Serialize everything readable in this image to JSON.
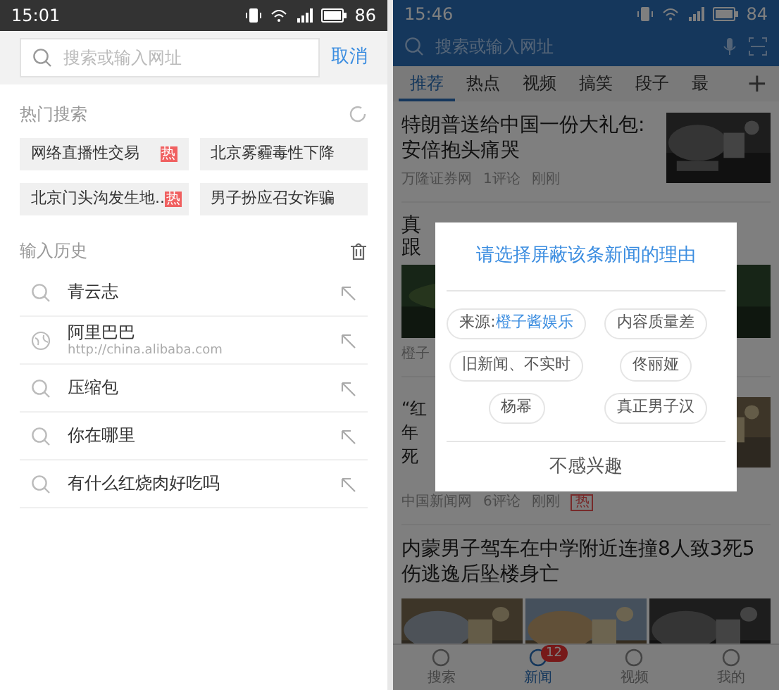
{
  "left_screen": {
    "status_bar": {
      "time": "15:01",
      "battery": "86"
    },
    "search": {
      "placeholder": "搜索或输入网址",
      "cancel": "取消"
    },
    "hot_search": {
      "title": "热门搜索",
      "items": [
        {
          "text": "网络直播性交易",
          "badge": "热"
        },
        {
          "text": "北京雾霾毒性下降"
        },
        {
          "text": "北京门头沟发生地..",
          "badge": "热"
        },
        {
          "text": "男子扮应召女诈骗"
        }
      ]
    },
    "history": {
      "title": "输入历史",
      "items": [
        {
          "kind": "query",
          "text": "青云志"
        },
        {
          "kind": "site",
          "text": "阿里巴巴",
          "url": "http://china.alibaba.com"
        },
        {
          "kind": "query",
          "text": "压缩包"
        },
        {
          "kind": "query",
          "text": "你在哪里"
        },
        {
          "kind": "query",
          "text": "有什么红烧肉好吃吗"
        }
      ]
    }
  },
  "right_screen": {
    "status_bar": {
      "time": "15:46",
      "battery": "84"
    },
    "search": {
      "placeholder": "搜索或输入网址"
    },
    "tabs": [
      {
        "label": "推荐",
        "selected": true
      },
      {
        "label": "热点",
        "selected": false
      },
      {
        "label": "视频",
        "selected": false
      },
      {
        "label": "搞笑",
        "selected": false
      },
      {
        "label": "段子",
        "selected": false
      },
      {
        "label": "最",
        "selected": false
      }
    ],
    "add_tab": "+",
    "news": [
      {
        "kind": "single",
        "title": "特朗普送给中国一份大礼包:安倍抱头痛哭",
        "source": "万隆证券网",
        "comments": "1评论",
        "time": "刚刚"
      },
      {
        "kind": "covered_wide",
        "fragments": [
          "真",
          "跟"
        ],
        "source": "橙子"
      },
      {
        "kind": "covered_single",
        "fragments": [
          "“红",
          "年",
          "死"
        ],
        "source": "中国新闻网",
        "comments": "6评论",
        "time": "刚刚",
        "badge": "热"
      },
      {
        "kind": "gallery",
        "title": "内蒙男子驾车在中学附近连撞8人致3死5伤逃逸后坠楼身亡"
      }
    ],
    "dialog": {
      "title": "请选择屏蔽该条新闻的理由",
      "reasons": [
        {
          "kind": "source",
          "label": "来源:",
          "value": "橙子酱娱乐"
        },
        {
          "kind": "plain",
          "label": "内容质量差"
        },
        {
          "kind": "plain",
          "label": "旧新闻、不实时"
        },
        {
          "kind": "plain",
          "label": "佟丽娅"
        },
        {
          "kind": "plain",
          "label": "杨幂"
        },
        {
          "kind": "plain",
          "label": "真正男子汉"
        }
      ],
      "dismiss": "不感兴趣"
    },
    "bottom_nav": [
      {
        "label": "搜索",
        "selected": false
      },
      {
        "label": "新闻",
        "selected": true,
        "badge": "12"
      },
      {
        "label": "视频",
        "selected": false
      },
      {
        "label": "我的",
        "selected": false
      }
    ]
  }
}
